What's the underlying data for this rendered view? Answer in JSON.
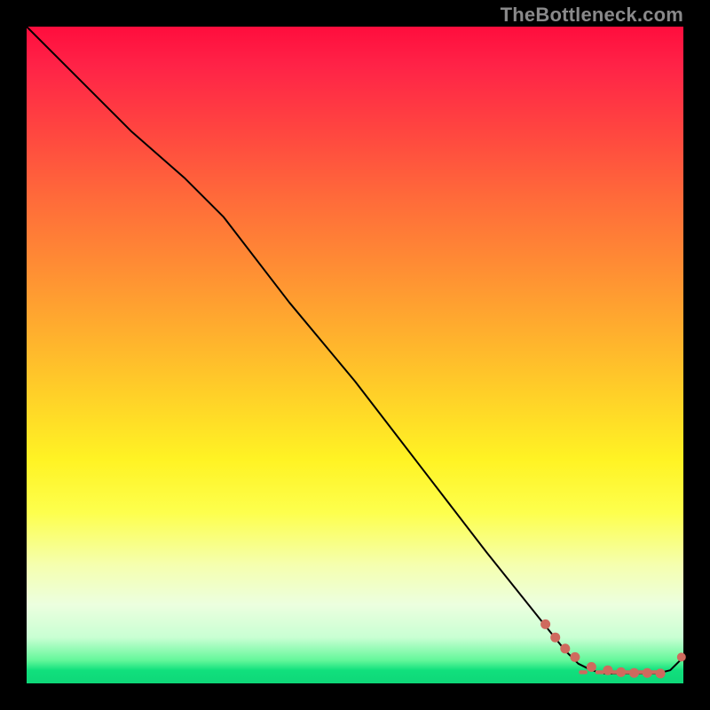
{
  "watermark": "TheBottleneck.com",
  "colors": {
    "background": "#000000",
    "curve": "#000000",
    "markers": "#cf6a5e",
    "gradient_top": "#ff0d3d",
    "gradient_bottom": "#0ed778"
  },
  "chart_data": {
    "type": "line",
    "title": "",
    "xlabel": "",
    "ylabel": "",
    "xlim": [
      0,
      100
    ],
    "ylim": [
      0,
      100
    ],
    "series": [
      {
        "name": "curve",
        "x": [
          0,
          8,
          16,
          24,
          30,
          40,
          50,
          60,
          70,
          78,
          82,
          84,
          86,
          88,
          90,
          92,
          94,
          96,
          98,
          100
        ],
        "y": [
          100,
          92,
          84,
          77,
          71,
          58,
          46,
          33,
          20,
          10,
          5,
          3,
          2,
          1.5,
          1.5,
          1.5,
          1.5,
          1.5,
          2,
          4
        ]
      }
    ],
    "markers": {
      "name": "points",
      "x": [
        79,
        80.5,
        82,
        83.5,
        86,
        88.5,
        90.5,
        92.5,
        94.5,
        96.5,
        99.7
      ],
      "y": [
        9,
        7,
        5.3,
        4,
        2.5,
        2,
        1.7,
        1.6,
        1.6,
        1.5,
        4
      ]
    },
    "dashes": {
      "x_pairs": [
        [
          84.1,
          85.4
        ],
        [
          86.6,
          88.0
        ],
        [
          89.0,
          90.2
        ],
        [
          91.0,
          92.2
        ],
        [
          93.0,
          94.2
        ],
        [
          95.0,
          96.2
        ]
      ],
      "y": 1.7
    }
  }
}
